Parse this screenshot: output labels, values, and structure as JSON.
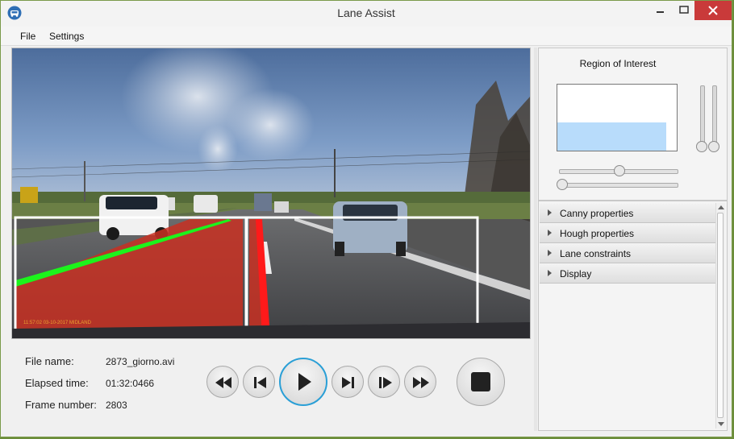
{
  "window": {
    "title": "Lane Assist",
    "buttons": {
      "minimize": "–",
      "maximize": "□",
      "close": "✕"
    }
  },
  "menu": {
    "items": [
      "File",
      "Settings"
    ]
  },
  "video": {
    "overlay_text": "11:57:02   03-10-2017     MIDLAND"
  },
  "roi": {
    "title": "Region of Interest",
    "fill_color": "#b8dcfb",
    "vertical_slider_1_level": 0.0,
    "vertical_slider_2_level": 0.0,
    "horizontal_slider_1_level": 0.52,
    "horizontal_slider_2_level": 0.0
  },
  "accordion": {
    "items": [
      "Canny properties",
      "Hough properties",
      "Lane constraints",
      "Display"
    ]
  },
  "info": {
    "file_name_label": "File name:",
    "file_name_value": "2873_giorno.avi",
    "elapsed_label": "Elapsed time:",
    "elapsed_value": "01:32:0466",
    "frame_label": "Frame number:",
    "frame_value": "2803"
  },
  "controls": {
    "icons": [
      "fast-rewind-icon",
      "skip-previous-icon",
      "play-icon",
      "skip-next-icon",
      "step-forward-icon",
      "fast-forward-icon",
      "stop-icon"
    ],
    "accent": "#2a9fd6"
  }
}
